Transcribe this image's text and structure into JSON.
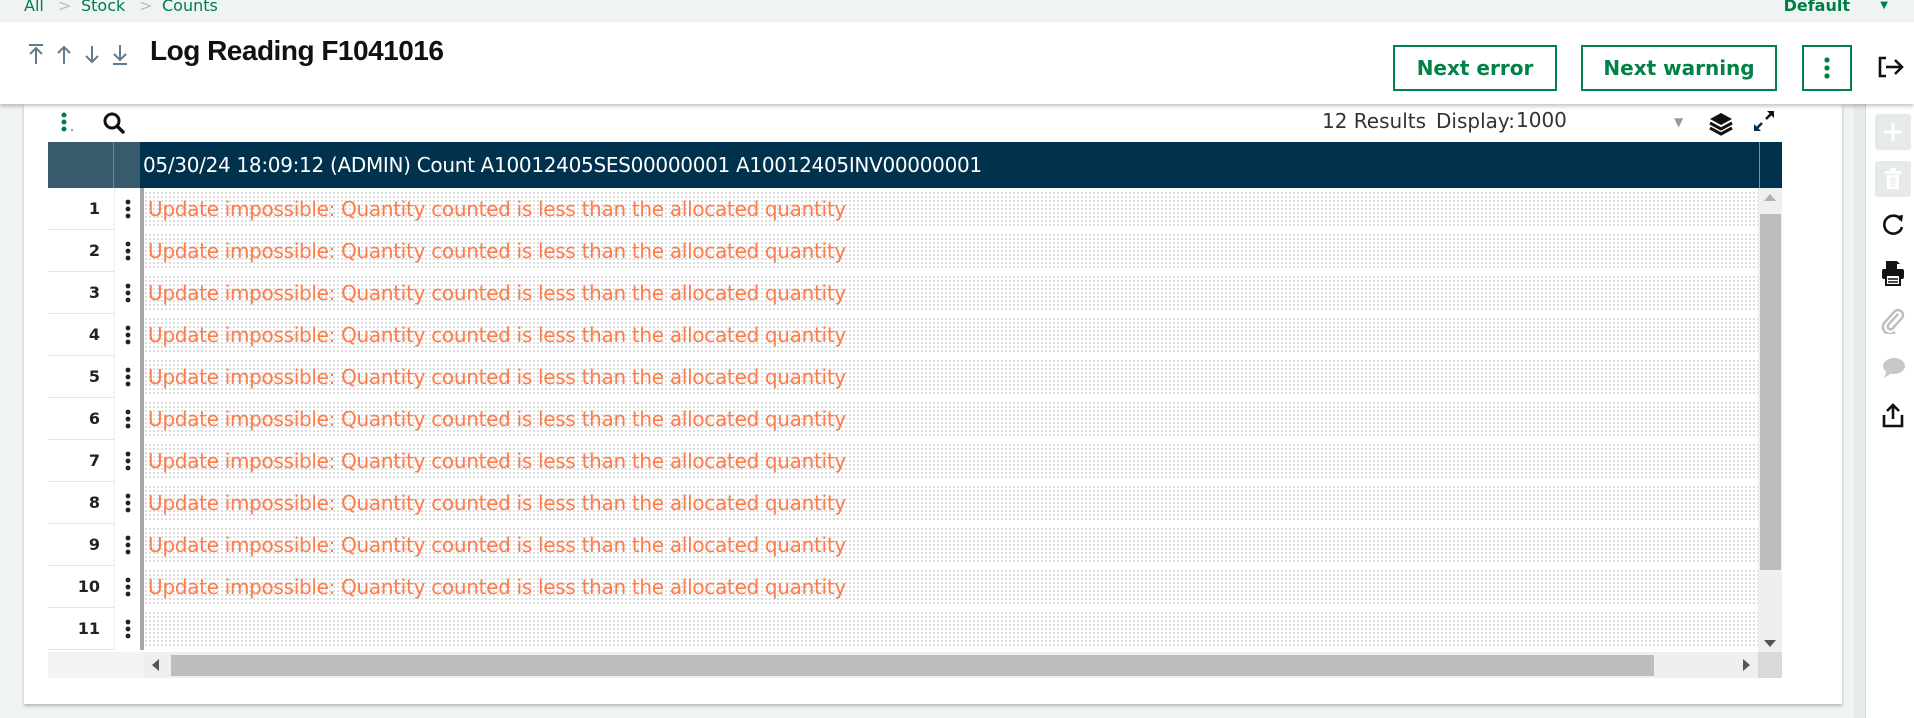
{
  "breadcrumb": [
    "All",
    "Stock",
    "Counts"
  ],
  "profile": {
    "label": "Default"
  },
  "header": {
    "title": "Log Reading F1041016",
    "nav_icons": [
      "first-record-icon",
      "previous-record-icon",
      "next-record-icon",
      "last-record-icon"
    ],
    "buttons": {
      "next_error": "Next error",
      "next_warning": "Next warning"
    }
  },
  "grid_toolbar": {
    "results": "12 Results",
    "display_label": "Display:",
    "display_value": "1000"
  },
  "grid": {
    "header_title": "05/30/24 18:09:12 (ADMIN) Count A10012405SES00000001 A10012405INV00000001",
    "rows": [
      {
        "num": "1",
        "text": "Update impossible: Quantity counted is less than the allocated quantity"
      },
      {
        "num": "2",
        "text": "Update impossible: Quantity counted is less than the allocated quantity"
      },
      {
        "num": "3",
        "text": "Update impossible: Quantity counted is less than the allocated quantity"
      },
      {
        "num": "4",
        "text": "Update impossible: Quantity counted is less than the allocated quantity"
      },
      {
        "num": "5",
        "text": "Update impossible: Quantity counted is less than the allocated quantity"
      },
      {
        "num": "6",
        "text": "Update impossible: Quantity counted is less than the allocated quantity"
      },
      {
        "num": "7",
        "text": "Update impossible: Quantity counted is less than the allocated quantity"
      },
      {
        "num": "8",
        "text": "Update impossible: Quantity counted is less than the allocated quantity"
      },
      {
        "num": "9",
        "text": "Update impossible: Quantity counted is less than the allocated quantity"
      },
      {
        "num": "10",
        "text": "Update impossible: Quantity counted is less than the allocated quantity"
      },
      {
        "num": "11",
        "text": ""
      }
    ]
  },
  "right_sidebar": {
    "icons": [
      "add-icon",
      "delete-icon",
      "refresh-icon",
      "print-icon",
      "attachment-icon",
      "comment-icon",
      "export-icon"
    ]
  },
  "colors": {
    "accent": "#008145",
    "header_bg": "#00314d",
    "error_text": "#ff7b48"
  }
}
